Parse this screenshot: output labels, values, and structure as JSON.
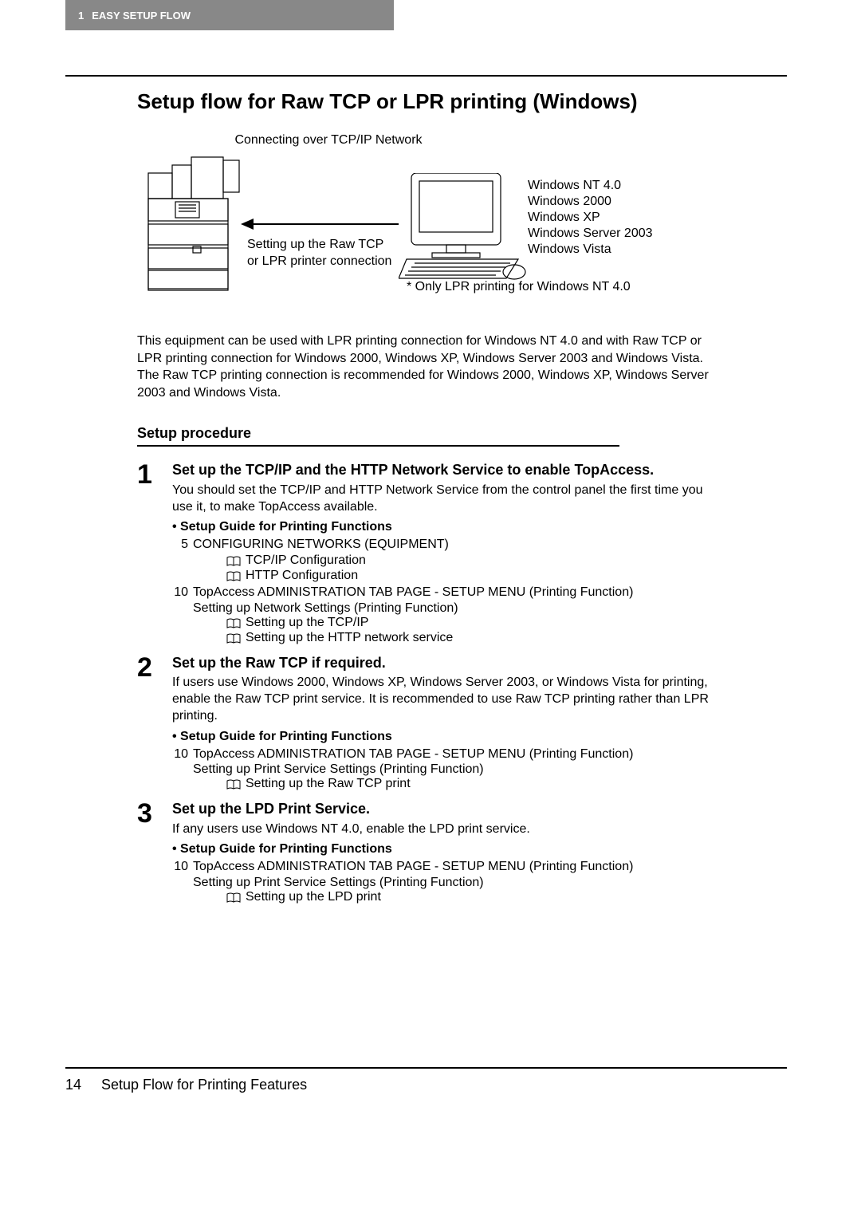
{
  "header": {
    "chapter_num": "1",
    "chapter_title": "EASY SETUP FLOW"
  },
  "title": "Setup flow for Raw TCP or LPR printing (Windows)",
  "diagram": {
    "caption": "Connecting over TCP/IP Network",
    "arrow_label_line1": "Setting up the Raw TCP",
    "arrow_label_line2": "or LPR printer connection",
    "os_list": [
      "Windows NT 4.0",
      "Windows 2000",
      "Windows XP",
      "Windows Server 2003",
      "Windows Vista"
    ],
    "footnote": "* Only LPR printing for Windows NT 4.0"
  },
  "intro": "This equipment can be used with LPR printing connection for Windows NT 4.0 and with Raw TCP or LPR printing connection for Windows 2000, Windows XP, Windows Server 2003 and Windows Vista. The Raw TCP printing connection is recommended for Windows 2000, Windows XP, Windows Server 2003 and Windows Vista.",
  "setup_heading": "Setup procedure",
  "steps": [
    {
      "num": "1",
      "title": "Set up the TCP/IP and the HTTP Network Service to enable TopAccess.",
      "desc": "You should set the TCP/IP and HTTP Network Service from the control panel the first time you use it, to make TopAccess available.",
      "guide_label": "Setup Guide for Printing Functions",
      "refs": [
        {
          "num": "5",
          "text": "CONFIGURING NETWORKS (EQUIPMENT)",
          "booklets": [
            "TCP/IP Configuration",
            "HTTP Configuration"
          ]
        },
        {
          "num": "10",
          "text": "TopAccess ADMINISTRATION TAB PAGE - SETUP MENU (Printing Function)",
          "sub": "Setting up Network Settings (Printing Function)",
          "booklets": [
            "Setting up the TCP/IP",
            "Setting up the HTTP network service"
          ]
        }
      ]
    },
    {
      "num": "2",
      "title": "Set up the Raw TCP if required.",
      "desc": "If users use Windows 2000, Windows XP, Windows Server 2003, or Windows Vista for printing, enable the Raw TCP print service. It is recommended to use Raw TCP printing rather than LPR printing.",
      "guide_label": "Setup Guide for Printing Functions",
      "refs": [
        {
          "num": "10",
          "text": "TopAccess ADMINISTRATION TAB PAGE - SETUP MENU (Printing Function)",
          "sub": "Setting up Print Service Settings (Printing Function)",
          "booklets": [
            "Setting up the Raw TCP print"
          ]
        }
      ]
    },
    {
      "num": "3",
      "title": "Set up the LPD Print Service.",
      "desc": "If any users use Windows NT 4.0, enable the LPD print service.",
      "guide_label": "Setup Guide for Printing Functions",
      "refs": [
        {
          "num": "10",
          "text": "TopAccess ADMINISTRATION TAB PAGE - SETUP MENU (Printing Function)",
          "sub": "Setting up Print Service Settings (Printing Function)",
          "booklets": [
            "Setting up the LPD print"
          ]
        }
      ]
    }
  ],
  "footer": {
    "page_num": "14",
    "section": "Setup Flow for Printing Features"
  }
}
